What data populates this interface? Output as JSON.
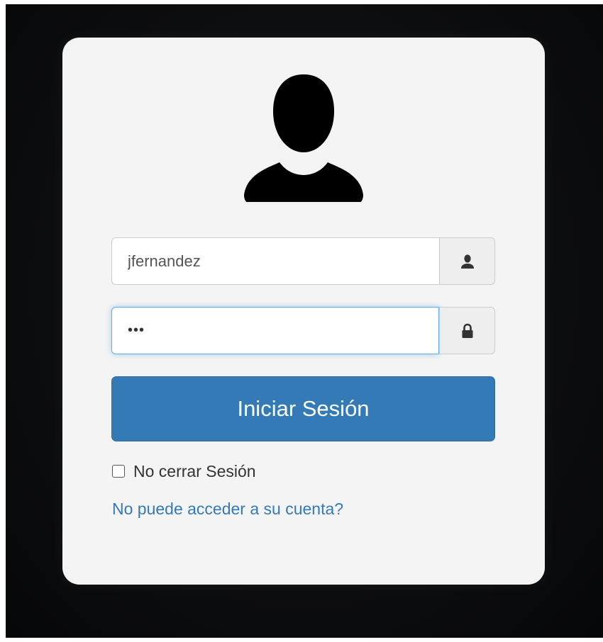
{
  "login": {
    "username_value": "jfernandez",
    "password_value": "•••",
    "submit_label": "Iniciar Sesión",
    "remember_label": "No cerrar Sesión",
    "remember_checked": false,
    "forgot_link": "No puede acceder a su cuenta?"
  },
  "icons": {
    "avatar": "user-silhouette-icon",
    "username_addon": "user-icon",
    "password_addon": "lock-icon"
  },
  "colors": {
    "primary": "#337ab7",
    "card_background": "#f4f4f4",
    "page_background": "#0d0e10",
    "focus_border": "#66afe9"
  }
}
